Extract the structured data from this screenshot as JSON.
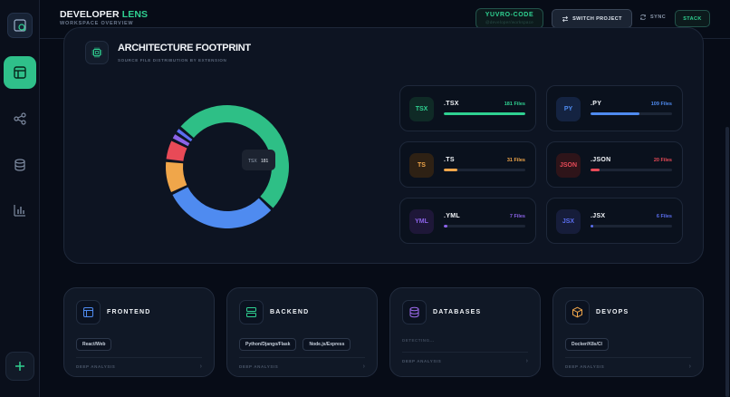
{
  "brand": {
    "name_part1": "DEVELOPER",
    "name_part2": "LENS",
    "subtitle": "WORKSPACE OVERVIEW"
  },
  "header": {
    "project_name": "YUVRO-CODE",
    "project_sub": "@developer/workspace",
    "switch_label": "SWITCH PROJECT",
    "sync_label": "SYNC",
    "stack_label": "STACK"
  },
  "sidebar": {
    "items": [
      "logo",
      "dashboard",
      "graph",
      "database",
      "analytics",
      "add"
    ]
  },
  "footprint": {
    "title": "ARCHITECTURE FOOTPRINT",
    "subtitle": "SOURCE FILE DISTRIBUTION BY EXTENSION",
    "tooltip_label": "TSX",
    "tooltip_value": "181"
  },
  "chart_data": {
    "type": "pie",
    "title": "ARCHITECTURE FOOTPRINT",
    "categories": [
      ".TSX",
      ".PY",
      ".TS",
      ".JSON",
      ".YML",
      ".JSX"
    ],
    "values": [
      181,
      109,
      31,
      20,
      7,
      6
    ],
    "colors": [
      "#2ebf86",
      "#4f8bf0",
      "#f0a64a",
      "#e84a57",
      "#8c63e8",
      "#5b6ef0"
    ]
  },
  "extensions": [
    {
      "badge": "TSX",
      "name": ".TSX",
      "count": "181 Files",
      "fill": 1.0,
      "color": "#2fd191",
      "badge_bg": "#0f2a26",
      "badge_fg": "#2fd191"
    },
    {
      "badge": "PY",
      "name": ".PY",
      "count": "109 Files",
      "fill": 0.6,
      "color": "#4f8bf0",
      "badge_bg": "#142341",
      "badge_fg": "#4f8bf0"
    },
    {
      "badge": "TS",
      "name": ".TS",
      "count": "31 Files",
      "fill": 0.17,
      "color": "#f0a64a",
      "badge_bg": "#2e2114",
      "badge_fg": "#f0a64a"
    },
    {
      "badge": "JSON",
      "name": ".JSON",
      "count": "20 Files",
      "fill": 0.11,
      "color": "#e84a57",
      "badge_bg": "#2e1419",
      "badge_fg": "#e84a57"
    },
    {
      "badge": "YML",
      "name": ".YML",
      "count": "7 Files",
      "fill": 0.04,
      "color": "#8c63e8",
      "badge_bg": "#1e1738",
      "badge_fg": "#8c63e8"
    },
    {
      "badge": "JSX",
      "name": ".JSX",
      "count": "6 Files",
      "fill": 0.03,
      "color": "#5b6ef0",
      "badge_bg": "#161d3a",
      "badge_fg": "#5b6ef0"
    }
  ],
  "categories": [
    {
      "title": "FRONTEND",
      "icon": "layout-icon",
      "color": "#4f8bf0",
      "tags": [
        "React/Web"
      ],
      "footer": "DEEP ANALYSIS"
    },
    {
      "title": "BACKEND",
      "icon": "server-icon",
      "color": "#2fd191",
      "tags": [
        "Python/Django/Flask",
        "Node.js/Express"
      ],
      "footer": "DEEP ANALYSIS"
    },
    {
      "title": "DATABASES",
      "icon": "database-icon",
      "color": "#a06cf0",
      "tags": [],
      "empty_text": "DETECTING...",
      "footer": "DEEP ANALYSIS"
    },
    {
      "title": "DEVOPS",
      "icon": "box-icon",
      "color": "#f0a64a",
      "tags": [
        "Docker/K8s/CI"
      ],
      "footer": "DEEP ANALYSIS"
    }
  ]
}
